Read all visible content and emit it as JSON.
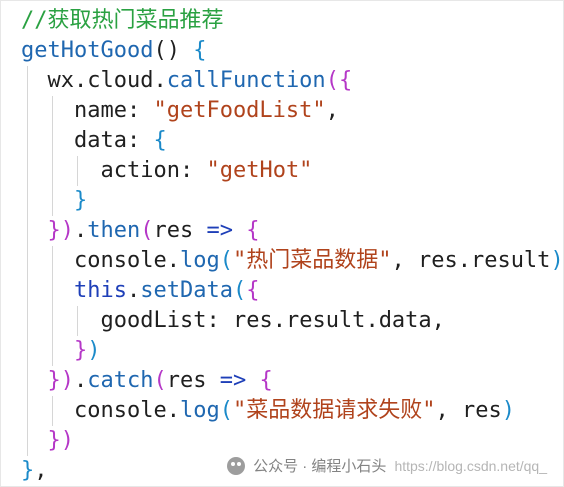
{
  "editor": {
    "lines": [
      [
        {
          "t": "//获取热门菜品推荐",
          "c": "comment"
        }
      ],
      [
        {
          "t": "getHotGood",
          "c": "fn"
        },
        {
          "t": "() ",
          "c": "punc"
        },
        {
          "t": "{",
          "c": "brace"
        }
      ],
      [
        {
          "t": "  ",
          "c": "punc"
        },
        {
          "t": "wx",
          "c": "prop"
        },
        {
          "t": ".",
          "c": "punc"
        },
        {
          "t": "cloud",
          "c": "prop"
        },
        {
          "t": ".",
          "c": "punc"
        },
        {
          "t": "callFunction",
          "c": "fn"
        },
        {
          "t": "(",
          "c": "paren"
        },
        {
          "t": "{",
          "c": "brace2"
        }
      ],
      [
        {
          "t": "    ",
          "c": "punc"
        },
        {
          "t": "name",
          "c": "prop"
        },
        {
          "t": ": ",
          "c": "punc"
        },
        {
          "t": "\"getFoodList\"",
          "c": "str"
        },
        {
          "t": ",",
          "c": "punc"
        }
      ],
      [
        {
          "t": "    ",
          "c": "punc"
        },
        {
          "t": "data",
          "c": "prop"
        },
        {
          "t": ": ",
          "c": "punc"
        },
        {
          "t": "{",
          "c": "brace"
        }
      ],
      [
        {
          "t": "      ",
          "c": "punc"
        },
        {
          "t": "action",
          "c": "prop"
        },
        {
          "t": ": ",
          "c": "punc"
        },
        {
          "t": "\"getHot\"",
          "c": "str"
        }
      ],
      [
        {
          "t": "    ",
          "c": "punc"
        },
        {
          "t": "}",
          "c": "brace"
        }
      ],
      [
        {
          "t": "  ",
          "c": "punc"
        },
        {
          "t": "}",
          "c": "brace2"
        },
        {
          "t": ")",
          "c": "paren"
        },
        {
          "t": ".",
          "c": "punc"
        },
        {
          "t": "then",
          "c": "fn"
        },
        {
          "t": "(",
          "c": "paren"
        },
        {
          "t": "res",
          "c": "prop"
        },
        {
          "t": " ",
          "c": "punc"
        },
        {
          "t": "=>",
          "c": "arrow"
        },
        {
          "t": " ",
          "c": "punc"
        },
        {
          "t": "{",
          "c": "brace2"
        }
      ],
      [
        {
          "t": "    ",
          "c": "punc"
        },
        {
          "t": "console",
          "c": "prop"
        },
        {
          "t": ".",
          "c": "punc"
        },
        {
          "t": "log",
          "c": "fn"
        },
        {
          "t": "(",
          "c": "paren2"
        },
        {
          "t": "\"热门菜品数据\"",
          "c": "str"
        },
        {
          "t": ", ",
          "c": "punc"
        },
        {
          "t": "res",
          "c": "prop"
        },
        {
          "t": ".",
          "c": "punc"
        },
        {
          "t": "result",
          "c": "prop"
        },
        {
          "t": ")",
          "c": "paren2"
        }
      ],
      [
        {
          "t": "    ",
          "c": "punc"
        },
        {
          "t": "this",
          "c": "kw"
        },
        {
          "t": ".",
          "c": "punc"
        },
        {
          "t": "setData",
          "c": "fn"
        },
        {
          "t": "(",
          "c": "paren2"
        },
        {
          "t": "{",
          "c": "brace2"
        }
      ],
      [
        {
          "t": "      ",
          "c": "punc"
        },
        {
          "t": "goodList",
          "c": "prop"
        },
        {
          "t": ": ",
          "c": "punc"
        },
        {
          "t": "res",
          "c": "prop"
        },
        {
          "t": ".",
          "c": "punc"
        },
        {
          "t": "result",
          "c": "prop"
        },
        {
          "t": ".",
          "c": "punc"
        },
        {
          "t": "data",
          "c": "prop"
        },
        {
          "t": ",",
          "c": "punc"
        }
      ],
      [
        {
          "t": "    ",
          "c": "punc"
        },
        {
          "t": "}",
          "c": "brace2"
        },
        {
          "t": ")",
          "c": "paren2"
        }
      ],
      [
        {
          "t": "  ",
          "c": "punc"
        },
        {
          "t": "}",
          "c": "brace2"
        },
        {
          "t": ")",
          "c": "paren"
        },
        {
          "t": ".",
          "c": "punc"
        },
        {
          "t": "catch",
          "c": "fn"
        },
        {
          "t": "(",
          "c": "paren"
        },
        {
          "t": "res",
          "c": "prop"
        },
        {
          "t": " ",
          "c": "punc"
        },
        {
          "t": "=>",
          "c": "arrow"
        },
        {
          "t": " ",
          "c": "punc"
        },
        {
          "t": "{",
          "c": "brace2"
        }
      ],
      [
        {
          "t": "    ",
          "c": "punc"
        },
        {
          "t": "console",
          "c": "prop"
        },
        {
          "t": ".",
          "c": "punc"
        },
        {
          "t": "log",
          "c": "fn"
        },
        {
          "t": "(",
          "c": "paren2"
        },
        {
          "t": "\"菜品数据请求失败\"",
          "c": "str"
        },
        {
          "t": ", ",
          "c": "punc"
        },
        {
          "t": "res",
          "c": "prop"
        },
        {
          "t": ")",
          "c": "paren2"
        }
      ],
      [
        {
          "t": "  ",
          "c": "punc"
        },
        {
          "t": "}",
          "c": "brace2"
        },
        {
          "t": ")",
          "c": "paren"
        }
      ],
      [
        {
          "t": "}",
          "c": "brace"
        },
        {
          "t": ",",
          "c": "punc"
        }
      ]
    ]
  },
  "watermark": {
    "icon": "wechat-icon",
    "text": "公众号 · 编程小石头",
    "url": "https://blog.csdn.net/qq_"
  },
  "colors": {
    "comment": "#2aa142",
    "function": "#1f67b0",
    "string": "#b0431c",
    "keyword": "#1e3fb8",
    "brace": "#1b8ac9",
    "brace_alt": "#b537c7"
  }
}
